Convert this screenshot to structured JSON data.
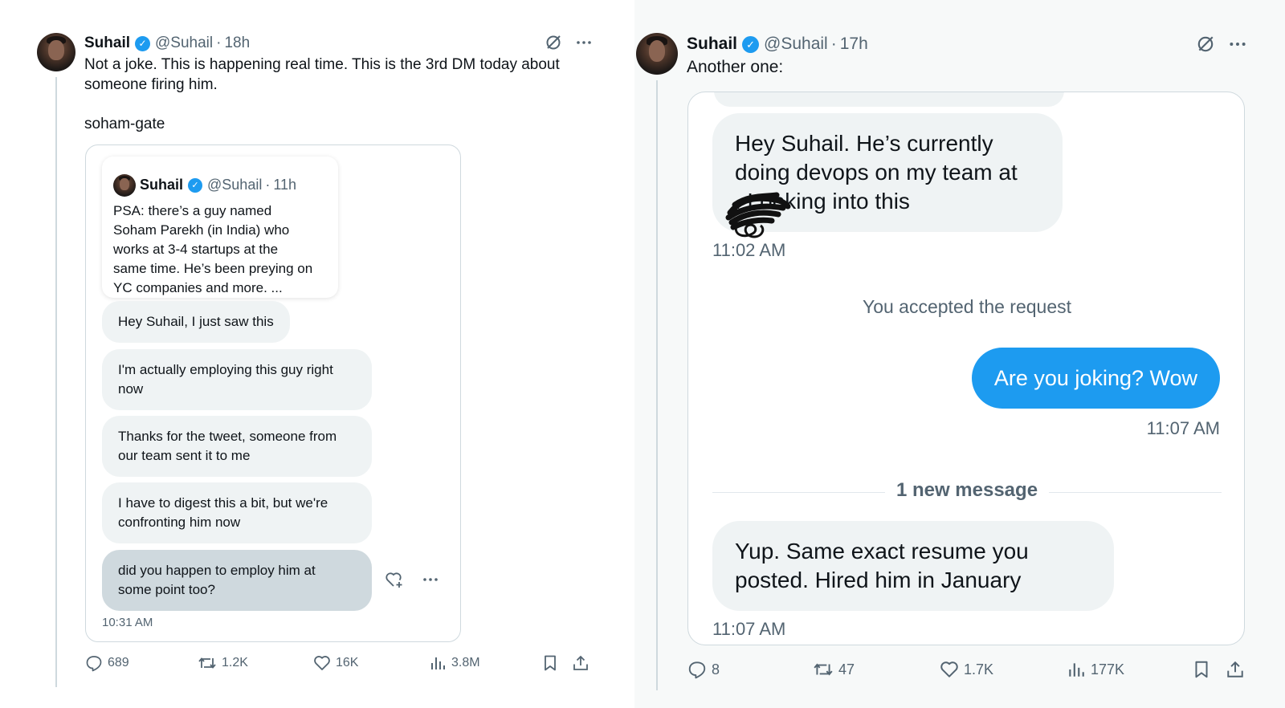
{
  "left_tweet": {
    "author_name": "Suhail",
    "author_handle": "@Suhail",
    "time": "18h",
    "text": "Not a joke. This is happening real time. This is the 3rd DM today about\nsomeone firing him.\n\nsoham-gate",
    "quoted": {
      "author_name": "Suhail",
      "author_handle": "@Suhail",
      "time": "11h",
      "text": "PSA: there’s a guy named\nSoham Parekh (in India) who\nworks at 3-4 startups at the\nsame time. He’s been preying on\nYC companies and more. ..."
    },
    "messages": [
      "Hey Suhail, I just saw this",
      "I'm actually employing this guy right\nnow",
      "Thanks for the tweet, someone from\nour team sent it to me",
      "I have to digest this a bit, but we're\nconfronting him now",
      "did you happen to employ him at\nsome point too?"
    ],
    "message_time": "10:31 AM",
    "stats": {
      "replies": "689",
      "reposts": "1.2K",
      "likes": "16K",
      "views": "3.8M"
    }
  },
  "right_tweet": {
    "author_name": "Suhail",
    "author_handle": "@Suhail",
    "time": "17h",
    "text": "Another one:",
    "messages": {
      "first": "Hey Suhail. He’s currently\ndoing devops on my team at\n      . Looking into this",
      "first_time": "11:02 AM",
      "system": "You accepted the request",
      "outgoing": "Are you joking? Wow",
      "outgoing_time": "11:07 AM",
      "new_message_label": "1 new message",
      "last": "Yup. Same exact resume you\nposted. Hired him in January",
      "last_time": "11:07 AM"
    },
    "stats": {
      "replies": "8",
      "reposts": "47",
      "likes": "1.7K",
      "views": "177K"
    }
  },
  "colors": {
    "accent_blue": "#1d9bf0",
    "muted_text": "#536471",
    "bubble_gray": "#eff3f4"
  }
}
